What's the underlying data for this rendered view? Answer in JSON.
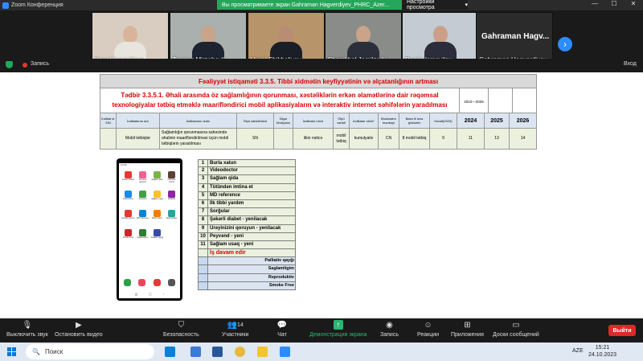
{
  "window": {
    "title": "Zoom Конференция",
    "share_banner": "Вы просматриваете экран Gahraman Hagverdiyev_PHRC_Azer...",
    "view_options": "Настройки просмотра"
  },
  "participants": [
    {
      "name": "Konul Ismayilova"
    },
    {
      "name": "Teymur Mirzabeyli"
    },
    {
      "name": "Vusal Shikhaliyev"
    },
    {
      "name": "Shamkhal Jamilzade"
    },
    {
      "name": "Rasim Ismayilov"
    },
    {
      "name": "Gahraman Hagverdiyev...",
      "big_label": "Gahraman Hagv..."
    }
  ],
  "status": {
    "recording_label": "Запись",
    "exit_label": "Вход"
  },
  "slide": {
    "header_title": "Fəaliyyət istiqaməti 3.3.5.  Tibbi xidmətin keyfiyyətinin və əlçatanlığının artması",
    "measure_text": "Tədbir 3.3.5.1. Əhali arasında öz sağlamlığının qorunması, xəstəliklərin erkən əlamətlərinə dair rəqəmsal texnologiyalar tətbiq etməklə maarifləndirici mobil aplikasiyaların və interaktiv internet səhifələrin yaradılması",
    "year_range": "2022—2026",
    "columns": [
      "İndikat or S/N",
      "İndikatorun adı",
      "İndikatorun izahı",
      "Ölçü vahidi/növü",
      "Digər tövsiyələr",
      "İndikator növü",
      "Ölçü vahidi",
      "İndikator növü*",
      "Məlumatın mənbəyi",
      "Baza ili üzrə göstərici",
      "Hədəf(2023)",
      "2024",
      "2025",
      "2026"
    ],
    "row": [
      "",
      "Mobil tətbiqlər",
      "Sağlamlığın qorunmasına sahəsində əhalinin maarifləndirilməsi üçün mobil tətbiqlərin yaradılması",
      "SN",
      "",
      "ilkin nəticə",
      "mobil tətbiq",
      "kumulyativ",
      "CN",
      "8 mobil tətbiq",
      "9",
      "11",
      "13",
      "14"
    ]
  },
  "phone": {
    "time": "13:06",
    "apps": [
      "Şəkərli diabet",
      "Ürəyinizi qoruyun",
      "Sağlam qida",
      "Tütündən imtina",
      "Videodoctor",
      "Peyvənd",
      "Sağlam uşaq",
      "Sorğular",
      "Ilk tibbi yardım",
      "MD reference",
      "Burla xətun",
      "Reproduktiv",
      "Smoke Free",
      "Sağlamlığım",
      "Palliativ qayğı"
    ]
  },
  "app_list": [
    {
      "n": "1",
      "t": "Burla xatun"
    },
    {
      "n": "2",
      "t": "Videodoctor"
    },
    {
      "n": "3",
      "t": "Sağlam qida"
    },
    {
      "n": "4",
      "t": "Tütündən imtina et"
    },
    {
      "n": "5",
      "t": "MD reference"
    },
    {
      "n": "6",
      "t": "İlk tibbi yardım"
    },
    {
      "n": "7",
      "t": "Sorğular"
    },
    {
      "n": "8",
      "t": "Şəkərli diabet - yenilacak"
    },
    {
      "n": "9",
      "t": "Ürəyinizini qoruyun - yenilacak"
    },
    {
      "n": "10",
      "t": "Peyvənd - yeni"
    },
    {
      "n": "11",
      "t": "Sağlam usaq - yeni"
    },
    {
      "n": "",
      "t": "İş davam edir",
      "style": "red"
    },
    {
      "n": "",
      "t": "Palliativ qayğı",
      "style": "blue"
    },
    {
      "n": "",
      "t": "Saglamligim",
      "style": "blue"
    },
    {
      "n": "",
      "t": "Reproduktiv",
      "style": "blue"
    },
    {
      "n": "",
      "t": "Smoke Free",
      "style": "blue"
    }
  ],
  "toolbar": {
    "mute": "Выключить звук",
    "stop_video": "Остановить видео",
    "security": "Безопасность",
    "participants": "Участники",
    "participants_count": "14",
    "chat": "Чат",
    "share": "Демонстрация экрана",
    "record": "Запись",
    "reactions": "Реакции",
    "apps": "Приложения",
    "whiteboards": "Доски сообщений",
    "leave": "Выйти"
  },
  "taskbar": {
    "search": "Поиск",
    "lang": "AZE",
    "time": "15:21",
    "date": "24.10.2023"
  },
  "colors": {
    "zoom_blue": "#2d8cff",
    "share_green": "#26a65b",
    "leave_red": "#e02828",
    "slide_red": "#d40000"
  }
}
